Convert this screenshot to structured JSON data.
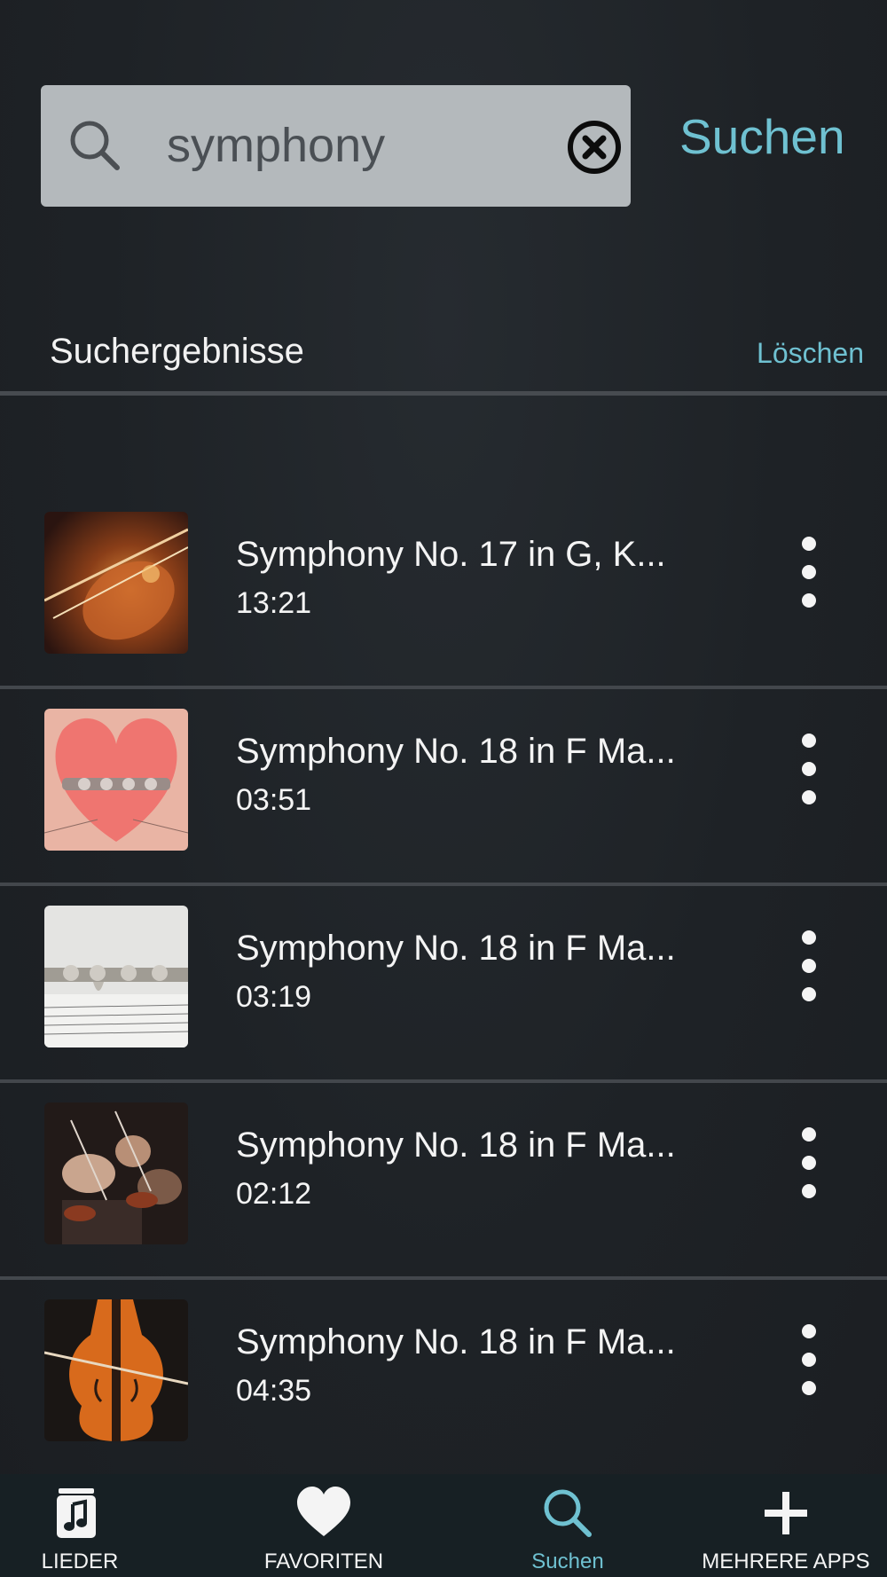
{
  "search": {
    "query": "symphony",
    "action_label": "Suchen"
  },
  "results": {
    "title": "Suchergebnisse",
    "clear_label": "Löschen",
    "items": [
      {
        "title": "Symphony No. 17 in G, K...",
        "duration": "13:21",
        "thumb": "violin-closeup"
      },
      {
        "title": "Symphony No. 18 in F Ma...",
        "duration": "03:51",
        "thumb": "flute-heart"
      },
      {
        "title": "Symphony No. 18 in F Ma...",
        "duration": "03:19",
        "thumb": "flute-sheet-music"
      },
      {
        "title": "Symphony No. 18 in F Ma...",
        "duration": "02:12",
        "thumb": "orchestra-violins"
      },
      {
        "title": "Symphony No. 18 in F Ma...",
        "duration": "04:35",
        "thumb": "cello"
      }
    ]
  },
  "tabbar": {
    "tabs": [
      {
        "label": "LIEDER",
        "icon": "music-note-icon",
        "active": false
      },
      {
        "label": "FAVORITEN",
        "icon": "heart-icon",
        "active": false
      },
      {
        "label": "Suchen",
        "icon": "search-icon",
        "active": true
      },
      {
        "label": "MEHRERE APPS",
        "icon": "plus-icon",
        "active": false
      }
    ]
  },
  "colors": {
    "accent": "#6fc1d1",
    "background": "#1e2226",
    "search_field": "#b4b9bc",
    "tabbar": "#172024"
  }
}
